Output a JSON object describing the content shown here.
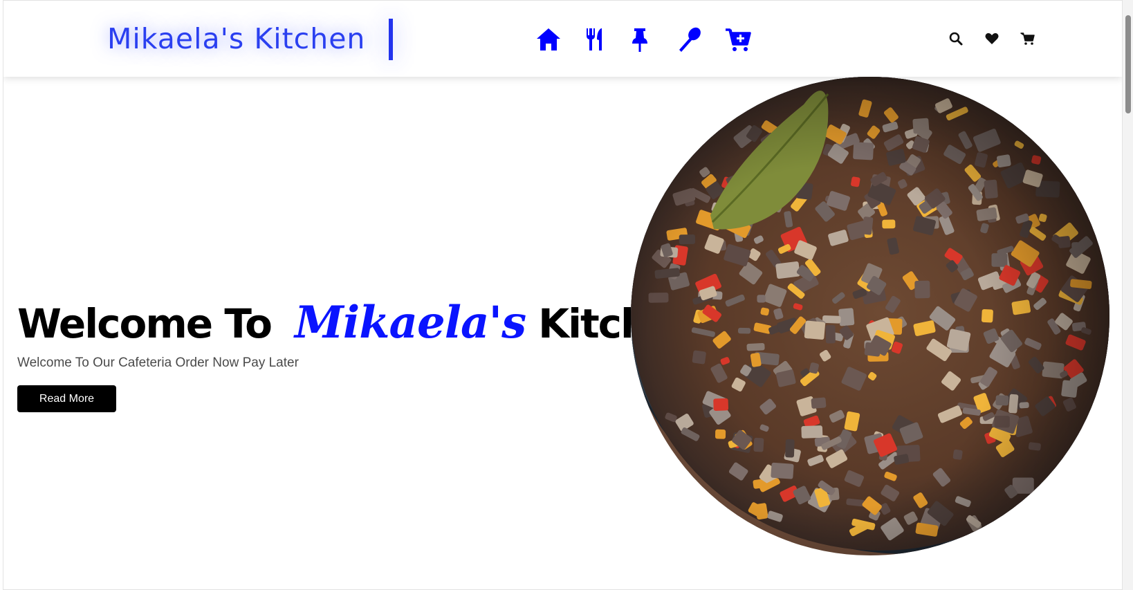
{
  "header": {
    "brand": "Mikaela's Kitchen",
    "nav": [
      {
        "icon": "home-icon"
      },
      {
        "icon": "utensils-icon"
      },
      {
        "icon": "pin-icon"
      },
      {
        "icon": "spoon-icon"
      },
      {
        "icon": "cart-plus-icon"
      }
    ],
    "utilities": [
      {
        "icon": "search-icon"
      },
      {
        "icon": "heart-icon"
      },
      {
        "icon": "cart-icon"
      }
    ],
    "accent_color": "#0000ff"
  },
  "hero": {
    "title_prefix": "Welcome To",
    "title_brand": "Mikaela's",
    "title_suffix": "Kitchen",
    "subtitle": "Welcome To Our Cafeteria Order Now Pay Later",
    "button_label": "Read More"
  }
}
